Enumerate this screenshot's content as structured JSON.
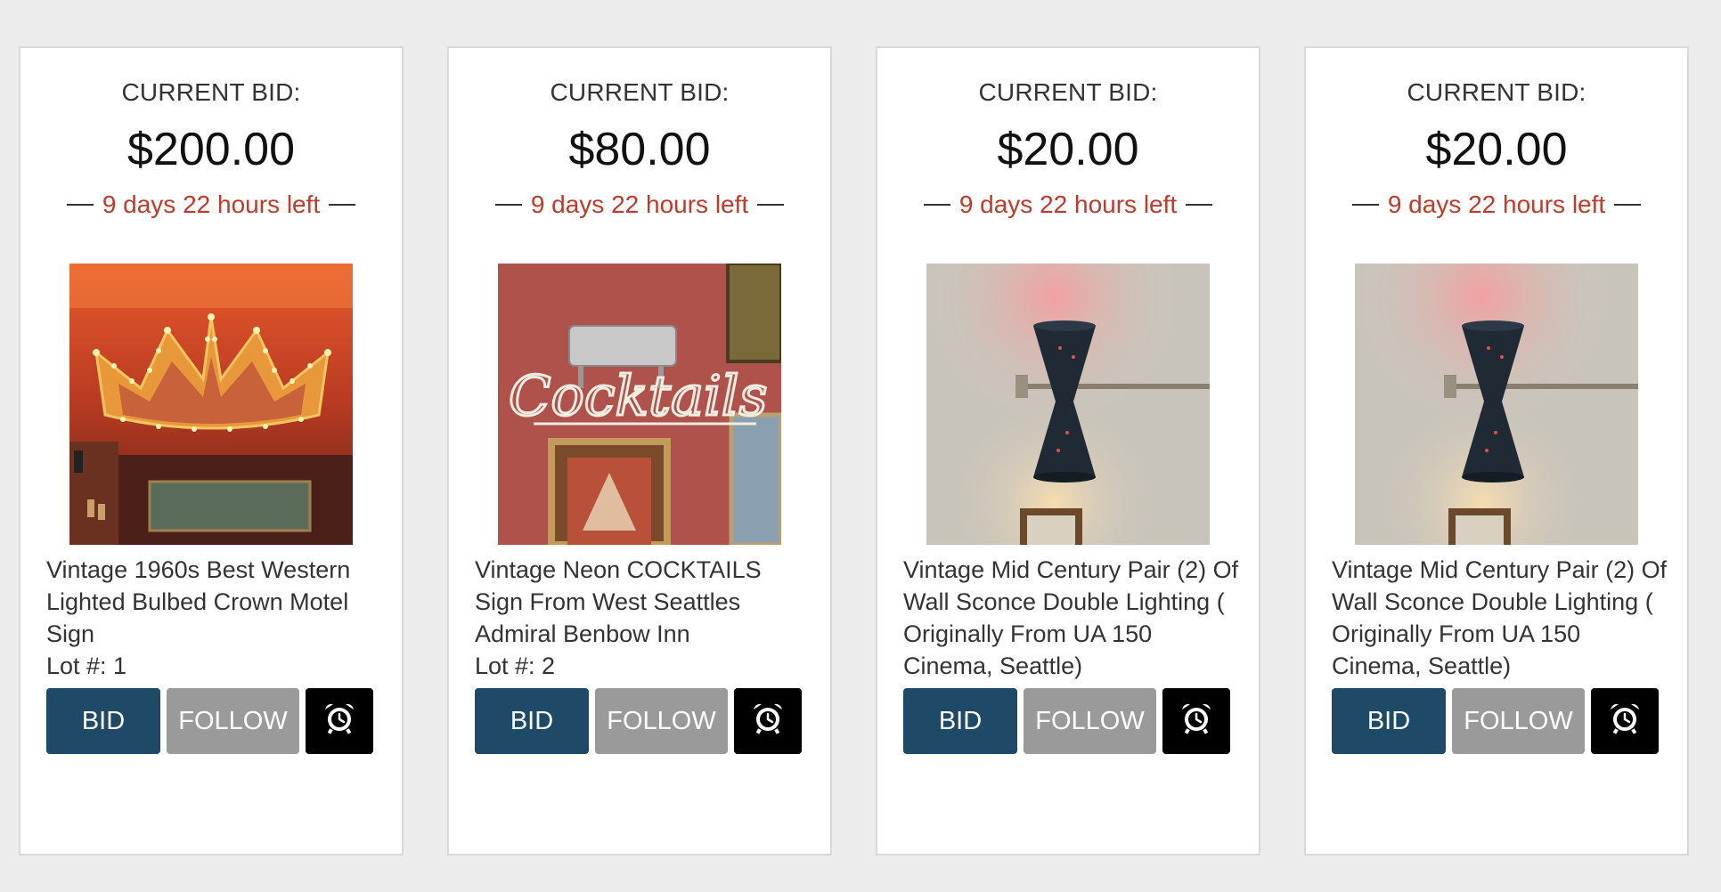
{
  "cards": [
    {
      "bid_label": "CURRENT BID:",
      "bid_amount": "$200.00",
      "time_left": "9 days 22 hours left",
      "title": "Vintage 1960s Best Western Lighted Bulbed Crown Motel Sign",
      "lot": "Lot #: 1",
      "bid_button": "BID",
      "follow_button": "FOLLOW",
      "alarm_icon": "alarm-clock-icon",
      "image": "crown-motel-sign"
    },
    {
      "bid_label": "CURRENT BID:",
      "bid_amount": "$80.00",
      "time_left": "9 days 22 hours left",
      "title": "Vintage Neon COCKTAILS Sign From West Seattles Admiral Benbow Inn",
      "lot": "Lot #: 2",
      "bid_button": "BID",
      "follow_button": "FOLLOW",
      "alarm_icon": "alarm-clock-icon",
      "image": "neon-cocktails-sign",
      "image_text": "Cocktails"
    },
    {
      "bid_label": "CURRENT BID:",
      "bid_amount": "$20.00",
      "time_left": "9 days 22 hours left",
      "title": "Vintage Mid Century Pair (2) Of Wall Sconce Double Lighting ( Originally From UA 150 Cinema, Seattle)",
      "lot": "",
      "bid_button": "BID",
      "follow_button": "FOLLOW",
      "alarm_icon": "alarm-clock-icon",
      "image": "wall-sconce"
    },
    {
      "bid_label": "CURRENT BID:",
      "bid_amount": "$20.00",
      "time_left": "9 days 22 hours left",
      "title": "Vintage Mid Century Pair (2) Of Wall Sconce Double Lighting ( Originally From UA 150 Cinema, Seattle)",
      "lot": "",
      "bid_button": "BID",
      "follow_button": "FOLLOW",
      "alarm_icon": "alarm-clock-icon",
      "image": "wall-sconce"
    }
  ],
  "colors": {
    "bid_button": "#1e4a68",
    "follow_button": "#9a9a9a",
    "alarm_button": "#000000",
    "time_left": "#c0392b"
  }
}
